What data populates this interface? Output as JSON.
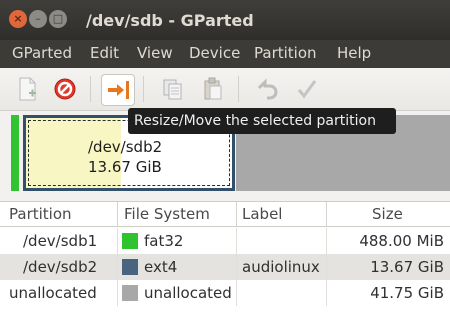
{
  "window": {
    "title": "/dev/sdb - GParted",
    "close_glyph": "×",
    "min_glyph": "–",
    "max_glyph": "□"
  },
  "menu": [
    "GParted",
    "Edit",
    "View",
    "Device",
    "Partition",
    "Help"
  ],
  "toolbar": {
    "buttons": [
      {
        "icon": "new-partition-icon",
        "active": false
      },
      {
        "icon": "delete-icon",
        "active": false
      },
      {
        "icon": "resize-move-icon",
        "active": true
      },
      {
        "icon": "copy-icon",
        "active": false
      },
      {
        "icon": "paste-icon",
        "active": false
      },
      {
        "icon": "undo-icon",
        "active": false
      },
      {
        "icon": "apply-icon",
        "active": false
      }
    ],
    "tooltip": "Resize/Move the selected partition"
  },
  "diskmap": {
    "selected": {
      "name": "/dev/sdb2",
      "size": "13.67 GiB",
      "fill_color": "#f8f6c2",
      "border_color": "#33506b"
    },
    "first_color": "#31c331",
    "unallocated_color": "#a8a8a8"
  },
  "table": {
    "headers": {
      "partition": "Partition",
      "filesystem": "File System",
      "label": "Label",
      "size": "Size"
    },
    "rows": [
      {
        "partition": "/dev/sdb1",
        "filesystem": "fat32",
        "fs_color": "#2fc32f",
        "label": "",
        "size": "488.00 MiB",
        "selected": false
      },
      {
        "partition": "/dev/sdb2",
        "filesystem": "ext4",
        "fs_color": "#49647f",
        "label": "audiolinux",
        "size": "13.67 GiB",
        "selected": true
      },
      {
        "partition": "unallocated",
        "filesystem": "unallocated",
        "fs_color": "#a8a8a8",
        "label": "",
        "size": "41.75 GiB",
        "selected": false
      }
    ]
  }
}
